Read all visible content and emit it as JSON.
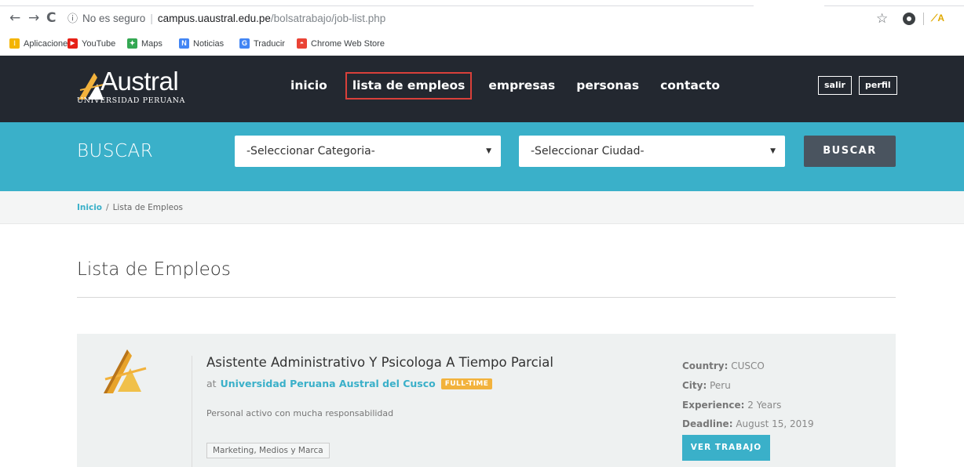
{
  "browser": {
    "security_label": "No es seguro",
    "url_host": "campus.uaustral.edu.pe",
    "url_path": "/bolsatrabajo/job-list.php",
    "back_icon": "←",
    "forward_icon": "→",
    "reload_icon": "C",
    "info_icon": "ⓘ",
    "star_icon": "☆"
  },
  "bookmarks": [
    {
      "label": "Aplicaciones",
      "color": "#f4b400",
      "glyph": "⁝"
    },
    {
      "label": "YouTube",
      "color": "#e62117",
      "glyph": "▶"
    },
    {
      "label": "Maps",
      "color": "#34a853",
      "glyph": "✦"
    },
    {
      "label": "Noticias",
      "color": "#4285f4",
      "glyph": "N"
    },
    {
      "label": "Traducir",
      "color": "#4285f4",
      "glyph": "G"
    },
    {
      "label": "Chrome Web Store",
      "color": "#ea4335",
      "glyph": "◓"
    }
  ],
  "site": {
    "logo_word": "Austral",
    "logo_sub": "UNIVERSIDAD PERUANA",
    "nav": [
      "inicio",
      "lista de empleos",
      "empresas",
      "personas",
      "contacto"
    ],
    "btn_salir": "salir",
    "btn_perfil": "perfil"
  },
  "search": {
    "title": "BUSCAR",
    "category_value": "-Seleccionar Categoria-",
    "city_value": "-Seleccionar Ciudad-",
    "button": "BUSCAR"
  },
  "breadcrumb": {
    "home": "Inicio",
    "sep": "/",
    "current": "Lista de Empleos"
  },
  "page_title": "Lista de Empleos",
  "job": {
    "title": "Asistente Administrativo Y Psicologa A Tiempo Parcial",
    "at": "at",
    "company": "Universidad Peruana Austral del Cusco",
    "badge": "FULL-TIME",
    "description": "Personal activo  con mucha responsabilidad",
    "tag": "Marketing, Medios y Marca",
    "country_label": "Country:",
    "country": "CUSCO",
    "city_label": "City:",
    "city": "Peru",
    "experience_label": "Experience:",
    "experience": "2 Years",
    "deadline_label": "Deadline:",
    "deadline": "August 15, 2019",
    "button": "VER TRABAJO"
  },
  "colors": {
    "header_bg": "#232830",
    "accent": "#3ab0c9",
    "badge": "#f2b23c",
    "active_nav_border": "#d9403a",
    "button_dark": "#4a545f"
  }
}
